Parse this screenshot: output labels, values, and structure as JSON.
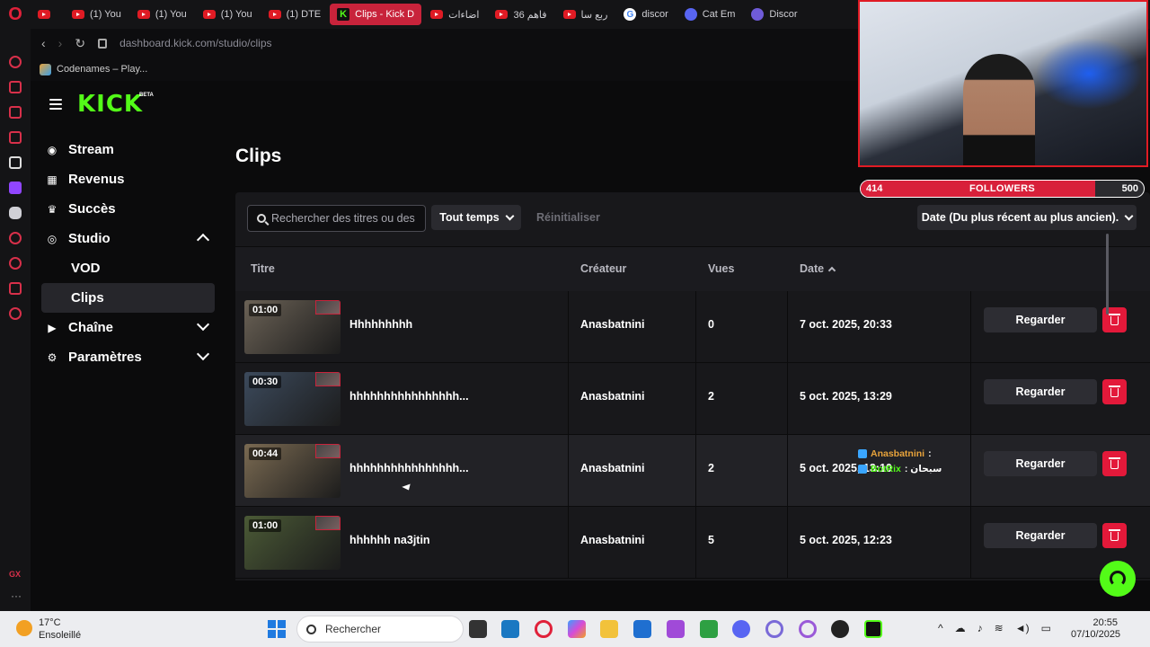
{
  "browser": {
    "tabs": [
      {
        "label": "",
        "type": "yt"
      },
      {
        "label": "(1) You",
        "type": "yt"
      },
      {
        "label": "(1) You",
        "type": "yt"
      },
      {
        "label": "(1) You",
        "type": "yt"
      },
      {
        "label": "(1) DTE",
        "type": "yt"
      },
      {
        "label": "Clips - Kick D",
        "type": "kick",
        "active": true
      },
      {
        "label": "اضاءات",
        "type": "yt"
      },
      {
        "label": "فاهم 36",
        "type": "yt"
      },
      {
        "label": "ربع سا",
        "type": "yt"
      },
      {
        "label": "discor",
        "type": "google"
      },
      {
        "label": "Cat Em",
        "type": "discord"
      },
      {
        "label": "Discor",
        "type": "purple"
      }
    ],
    "url": "dashboard.kick.com/studio/clips",
    "bookmark": "Codenames – Play..."
  },
  "brand": {
    "logo": "KICK",
    "beta": "BETA",
    "accent": "#53fc18",
    "danger": "#e3193a"
  },
  "sidebar": {
    "items": [
      {
        "label": "Stream",
        "icon": "broadcast-icon"
      },
      {
        "label": "Revenus",
        "icon": "revenue-icon"
      },
      {
        "label": "Succès",
        "icon": "trophy-icon"
      },
      {
        "label": "Studio",
        "icon": "studio-icon",
        "expanded": true
      },
      {
        "label": "VOD",
        "sub": true
      },
      {
        "label": "Clips",
        "sub": true,
        "selected": true
      },
      {
        "label": "Chaîne",
        "icon": "channel-icon"
      },
      {
        "label": "Paramètres",
        "icon": "gear-icon"
      }
    ]
  },
  "page": {
    "title": "Clips",
    "search_placeholder": "Rechercher des titres ou des",
    "time_filter": "Tout temps",
    "reset": "Réinitialiser",
    "sort": "Date (Du plus récent au plus ancien)."
  },
  "table": {
    "headers": {
      "title": "Titre",
      "creator": "Créateur",
      "views": "Vues",
      "date": "Date"
    },
    "watch_label": "Regarder",
    "rows": [
      {
        "duration": "01:00",
        "title": "Hhhhhhhhh",
        "creator": "Anasbatnini",
        "views": "0",
        "date": "7 oct. 2025, 20:33",
        "thumb": "#6b6256"
      },
      {
        "duration": "00:30",
        "title": "hhhhhhhhhhhhhhhh...",
        "creator": "Anasbatnini",
        "views": "2",
        "date": "5 oct. 2025, 13:29",
        "thumb": "#3c4a5c"
      },
      {
        "duration": "00:44",
        "title": "hhhhhhhhhhhhhhhh...",
        "creator": "Anasbatnini",
        "views": "2",
        "date": "5 oct. 2025, 13:10",
        "thumb": "#7a6a52"
      },
      {
        "duration": "01:00",
        "title": "hhhhhh na3jtin",
        "creator": "Anasbatnini",
        "views": "5",
        "date": "5 oct. 2025, 12:23",
        "thumb": "#4b5a36"
      }
    ]
  },
  "overlay": {
    "followers_current": "414",
    "followers_label": "FOLLOWERS",
    "followers_goal": "500",
    "followers_progress": 0.828,
    "chat": [
      {
        "user": "Anasbatnini",
        "msg": ":"
      },
      {
        "user": "BotRix",
        "msg": ": سبحان"
      }
    ]
  },
  "taskbar": {
    "temperature": "17°C",
    "weather": "Ensoleillé",
    "search": "Rechercher",
    "time": "20:55",
    "date": "07/10/2025"
  }
}
